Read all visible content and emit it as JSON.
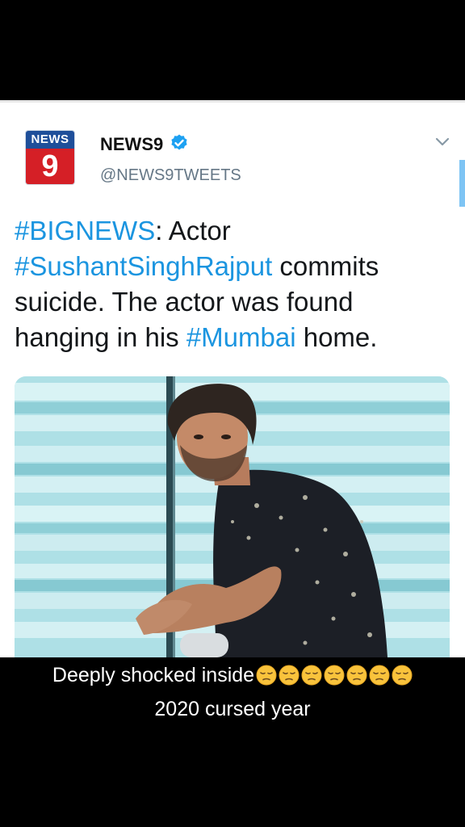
{
  "tweet": {
    "logo": {
      "top_text": "NEWS",
      "number": "9"
    },
    "display_name": "NEWS9",
    "handle": "@NEWS9TWEETS",
    "verified": true,
    "menu_icon": "chevron-down-icon",
    "text_parts": [
      {
        "text": "#BIGNEWS",
        "hashtag": true
      },
      {
        "text": ": Actor ",
        "hashtag": false
      },
      {
        "text": "#SushantSinghRajput",
        "hashtag": true
      },
      {
        "text": " commits suicide. The actor was found hanging in his ",
        "hashtag": false
      },
      {
        "text": "#Mumbai",
        "hashtag": true
      },
      {
        "text": " home.",
        "hashtag": false
      }
    ],
    "media_icon": "portrait-photo"
  },
  "caption": {
    "line1": "Deeply shocked inside",
    "emoji_count": 7,
    "emoji_icon": "pensive-face-icon",
    "line2": "2020 cursed year"
  },
  "colors": {
    "hashtag": "#1b95e0",
    "verified": "#1da1f2",
    "logo_blue": "#1f4f9a",
    "logo_red": "#d51f26"
  }
}
